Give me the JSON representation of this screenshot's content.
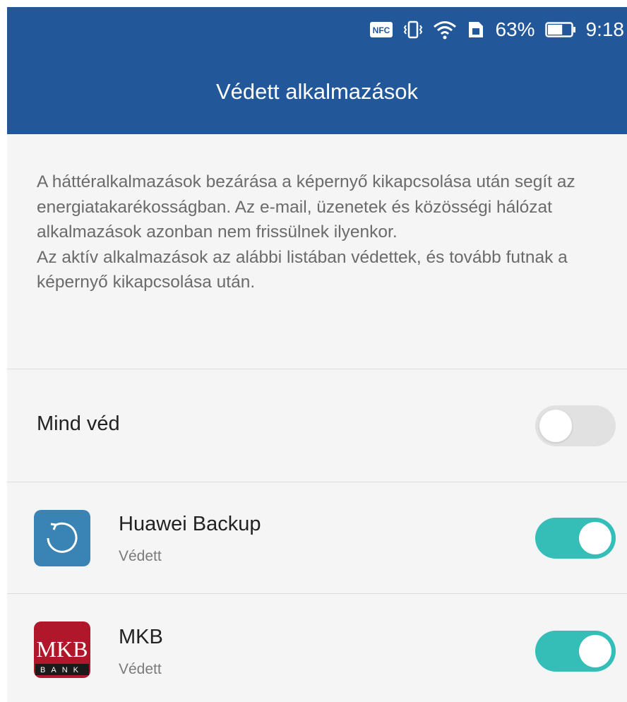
{
  "status_bar": {
    "nfc_label": "NFC",
    "battery_percent": "63%",
    "time": "9:18",
    "icons": [
      "nfc-icon",
      "vibrate-icon",
      "wifi-icon",
      "sim-card-icon",
      "battery-icon"
    ],
    "battery_level": 0.63
  },
  "header": {
    "title": "Védett alkalmazások"
  },
  "description": {
    "paragraph1": "A háttéralkalmazások bezárása a képernyő kikapcsolása után segít az energiatakarékosságban. Az e-mail, üzenetek és közösségi hálózat alkalmazások azonban nem frissülnek ilyenkor.",
    "paragraph2": "Az aktív alkalmazások az alábbi listában védettek, és tovább futnak a képernyő kikapcsolása után."
  },
  "protect_all": {
    "label": "Mind véd",
    "enabled": false
  },
  "apps": [
    {
      "name": "Huawei Backup",
      "status": "Védett",
      "enabled": true,
      "icon": "huawei-backup-icon"
    },
    {
      "name": "MKB",
      "status": "Védett",
      "enabled": true,
      "icon": "mkb-bank-icon",
      "icon_logo_text": "MKB",
      "icon_sub_text": "BANK"
    }
  ],
  "colors": {
    "header_bg": "#22589a",
    "toggle_on": "#35bdb7",
    "toggle_off": "#e1e1e1",
    "backup_icon_bg": "#3a83b5",
    "mkb_icon_bg": "#b0172a"
  }
}
